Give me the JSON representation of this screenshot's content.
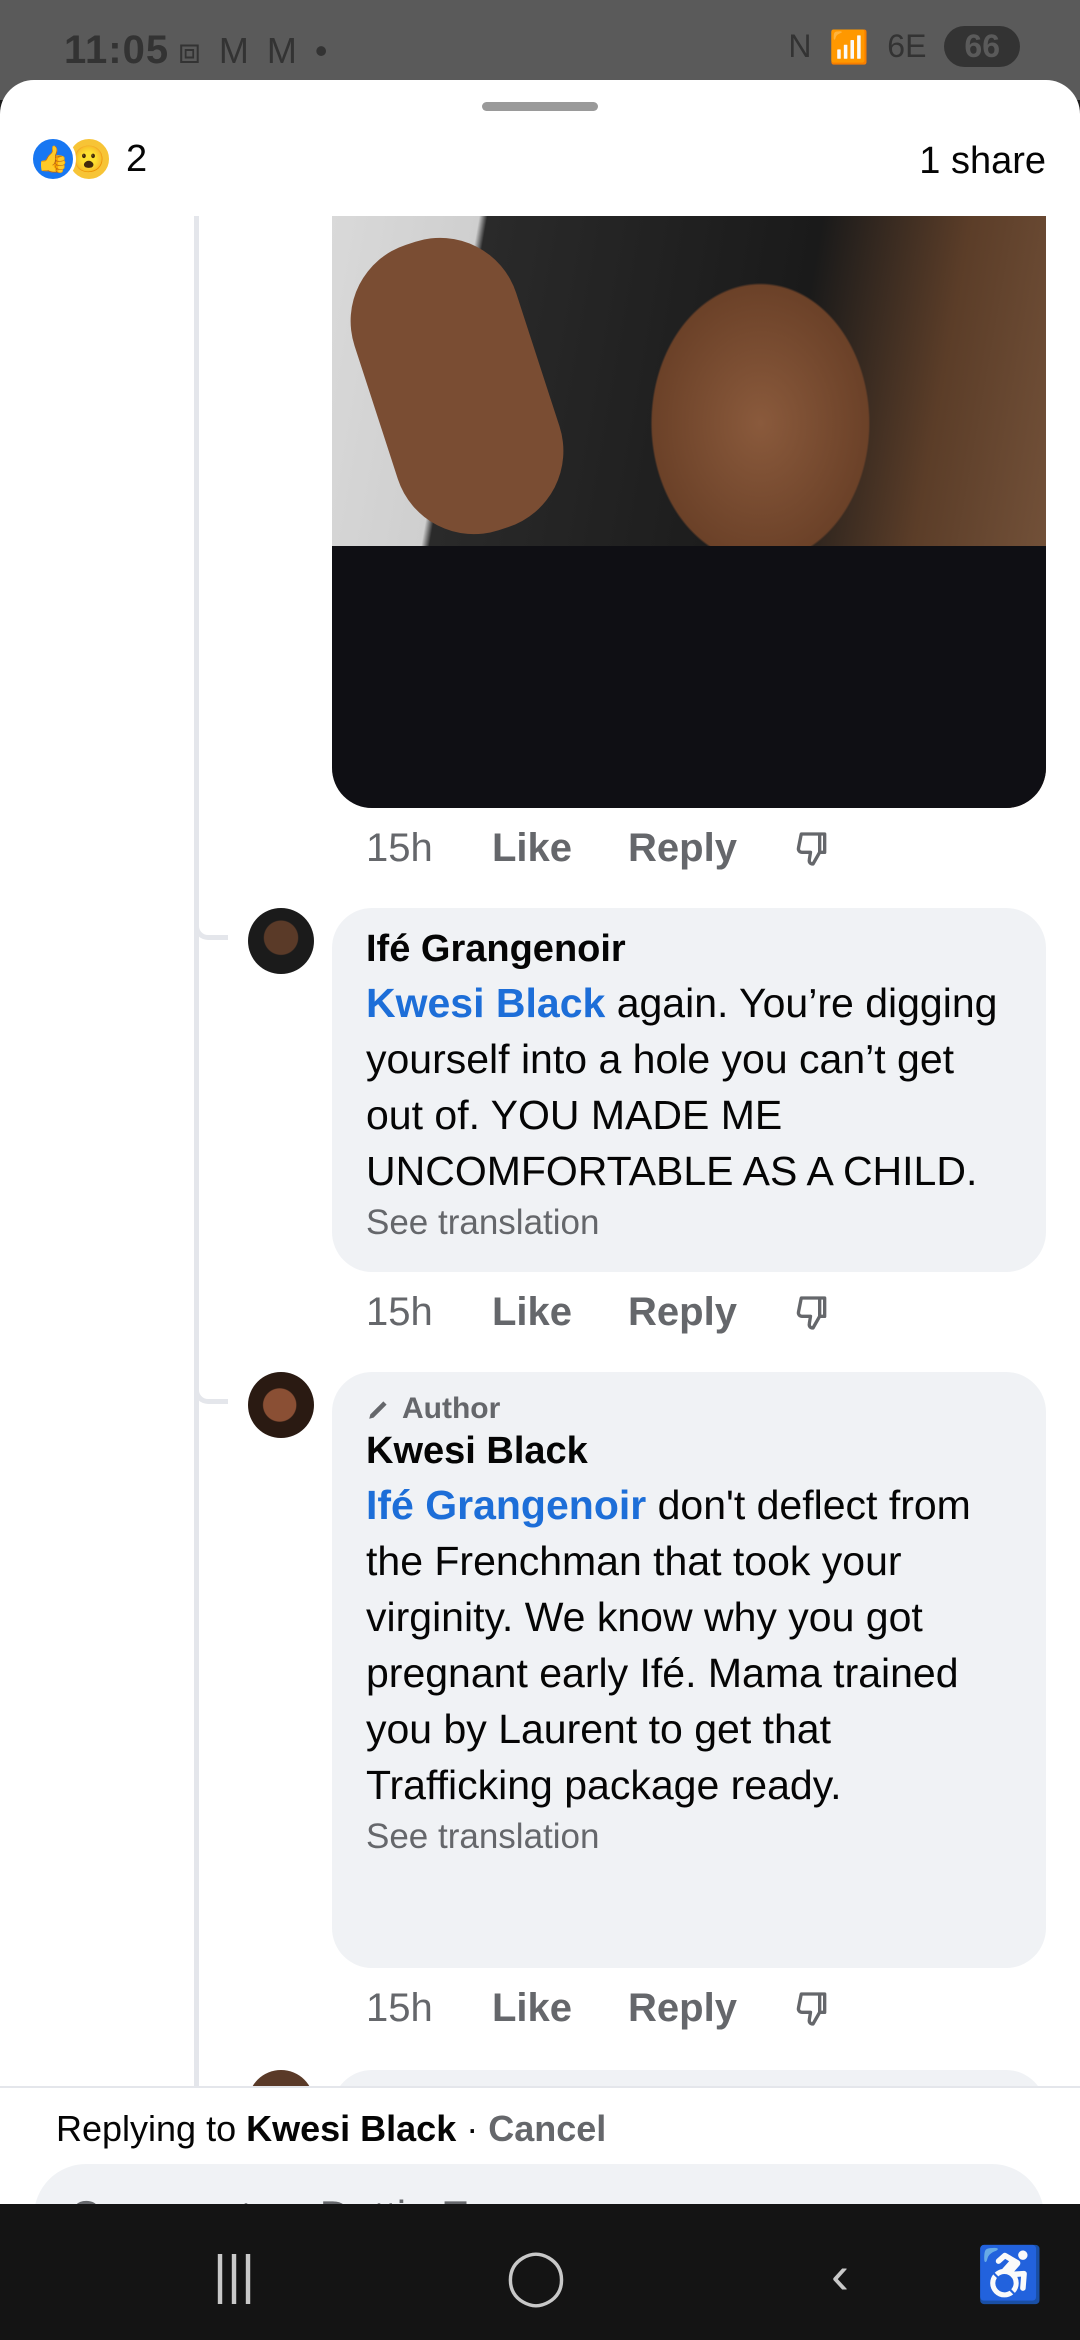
{
  "status_bar": {
    "time": "11:05",
    "left_icons": "⧈ M M •",
    "nfc": "N",
    "network": "6E",
    "battery": "66"
  },
  "sheet": {
    "reaction_count": "2",
    "share_count": "1 share"
  },
  "comments": [
    {
      "time": "15h",
      "like_label": "Like",
      "reply_label": "Reply"
    },
    {
      "author": "Ifé Grangenoir",
      "mention": "Kwesi Black",
      "text": " again. You’re digging yourself into a hole you can’t get out of. YOU MADE ME UNCOMFORTABLE AS A CHILD.",
      "see_translation": "See translation",
      "time": "15h",
      "like_label": "Like",
      "reply_label": "Reply"
    },
    {
      "badge": "Author",
      "author": "Kwesi Black",
      "mention": "Ifé Grangenoir",
      "text": " don't deflect from the Frenchman that took your virginity. We know why you got pregnant early Ifé. Mama trained you by Laurent to get that Trafficking package ready.",
      "see_translation": "See translation",
      "time": "15h",
      "like_label": "Like",
      "reply_label": "Reply"
    }
  ],
  "reply_bar": {
    "replying_prefix": "Replying to ",
    "replying_name": "Kwesi Black",
    "separator": " · ",
    "cancel": "Cancel",
    "placeholder": "Comment as Dottie Ess"
  },
  "colors": {
    "accent": "#1877f2",
    "mention": "#1d6ed8",
    "bubble": "#f0f2f5"
  }
}
